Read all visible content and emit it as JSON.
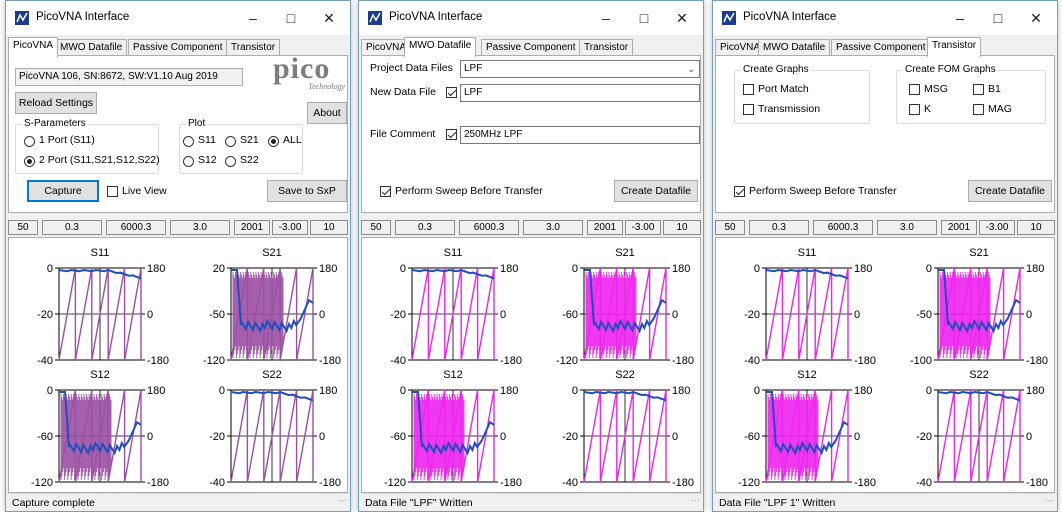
{
  "windows": [
    {
      "title": "PicoVNA Interface",
      "tabs": [
        "PicoVNA",
        "MWO Datafile",
        "Passive Component",
        "Transistor"
      ],
      "active_tab": 0,
      "device_info": "PicoVNA 106, SN:8672, SW:V1.10 Aug 2019",
      "logo": "pico",
      "logo_sub": "Technology",
      "reload_label": "Reload Settings",
      "about_label": "About",
      "sparams": {
        "title": "S-Parameters",
        "options": [
          {
            "label": "1 Port (S11)",
            "selected": false
          },
          {
            "label": "2 Port (S11,S21,S12,S22)",
            "selected": true
          }
        ]
      },
      "plot": {
        "title": "Plot",
        "options": [
          {
            "label": "S11",
            "selected": false
          },
          {
            "label": "S21",
            "selected": false
          },
          {
            "label": "ALL",
            "selected": true
          },
          {
            "label": "S12",
            "selected": false
          },
          {
            "label": "S22",
            "selected": false
          }
        ]
      },
      "capture_label": "Capture",
      "live_view_label": "Live View",
      "live_view_checked": false,
      "save_label": "Save to SxP",
      "status_fields": [
        "50",
        "0.3",
        "6000.3",
        "3.0",
        "2001",
        "-3.00",
        "10"
      ],
      "status_text": "Capture complete",
      "charts": [
        {
          "title": "S11",
          "left_ticks": [
            "0",
            "-20",
            "-40"
          ],
          "right_ticks": [
            "180",
            "0",
            "-180"
          ]
        },
        {
          "title": "S21",
          "left_ticks": [
            "20",
            "-50",
            "-120"
          ],
          "right_ticks": [
            "180",
            "0",
            "-180"
          ]
        },
        {
          "title": "S12",
          "left_ticks": [
            "0",
            "-60",
            "-120"
          ],
          "right_ticks": [
            "180",
            "0",
            "-180"
          ]
        },
        {
          "title": "S22",
          "left_ticks": [
            "0",
            "-20",
            "-40"
          ],
          "right_ticks": [
            "180",
            "0",
            "-180"
          ]
        }
      ],
      "phase_color": "#9b4fa3"
    },
    {
      "title": "PicoVNA Interface",
      "tabs": [
        "PicoVNA",
        "MWO Datafile",
        "Passive Component",
        "Transistor"
      ],
      "active_tab": 1,
      "project_label": "Project Data Files",
      "project_value": "LPF",
      "new_file_label": "New Data File",
      "new_file_checked": true,
      "new_file_value": "LPF",
      "comment_label": "File Comment",
      "comment_checked": true,
      "comment_value": "250MHz LPF",
      "sweep_label": "Perform Sweep Before Transfer",
      "sweep_checked": true,
      "create_label": "Create Datafile",
      "status_fields": [
        "50",
        "0.3",
        "6000.3",
        "3.0",
        "2001",
        "-3.00",
        "10"
      ],
      "status_text": "Data File \"LPF\" Written",
      "charts": [
        {
          "title": "S11",
          "left_ticks": [
            "0",
            "-20",
            "-40"
          ],
          "right_ticks": [
            "180",
            "0",
            "-180"
          ]
        },
        {
          "title": "S21",
          "left_ticks": [
            "0",
            "-60",
            "-120"
          ],
          "right_ticks": [
            "180",
            "0",
            "-180"
          ]
        },
        {
          "title": "S12",
          "left_ticks": [
            "0",
            "-60",
            "-120"
          ],
          "right_ticks": [
            "180",
            "0",
            "-180"
          ]
        },
        {
          "title": "S22",
          "left_ticks": [
            "0",
            "-20",
            "-40"
          ],
          "right_ticks": [
            "180",
            "0",
            "-180"
          ]
        }
      ],
      "phase_color": "#ee22ee"
    },
    {
      "title": "PicoVNA Interface",
      "tabs": [
        "PicoVNA",
        "MWO Datafile",
        "Passive Component",
        "Transistor"
      ],
      "active_tab": 3,
      "create_graphs": {
        "title": "Create Graphs",
        "options": [
          {
            "label": "Port Match",
            "checked": false
          },
          {
            "label": "Transmission",
            "checked": false
          }
        ]
      },
      "fom_graphs": {
        "title": "Create FOM Graphs",
        "options": [
          {
            "label": "MSG",
            "checked": false
          },
          {
            "label": "B1",
            "checked": false
          },
          {
            "label": "K",
            "checked": false
          },
          {
            "label": "MAG",
            "checked": false
          }
        ]
      },
      "sweep_label": "Perform Sweep Before Transfer",
      "sweep_checked": true,
      "create_label": "Create Datafile",
      "status_fields": [
        "50",
        "0.3",
        "6000.3",
        "3.0",
        "2001",
        "-3.00",
        "10"
      ],
      "status_text": "Data File \"LPF 1\" Written",
      "charts": [
        {
          "title": "S11",
          "left_ticks": [
            "0",
            "-20",
            "-40"
          ],
          "right_ticks": [
            "180",
            "0",
            "-180"
          ]
        },
        {
          "title": "S21",
          "left_ticks": [
            "0",
            "-50",
            "-100"
          ],
          "right_ticks": [
            "180",
            "0",
            "-180"
          ]
        },
        {
          "title": "S12",
          "left_ticks": [
            "0",
            "-60",
            "-120"
          ],
          "right_ticks": [
            "180",
            "0",
            "-180"
          ]
        },
        {
          "title": "S22",
          "left_ticks": [
            "0",
            "-20",
            "-40"
          ],
          "right_ticks": [
            "180",
            "0",
            "-180"
          ]
        }
      ],
      "phase_color": "#ee22ee"
    }
  ],
  "magnitude_color": "#1f4fbf",
  "title_icons": [
    "minimize-icon",
    "maximize-icon",
    "close-icon"
  ]
}
